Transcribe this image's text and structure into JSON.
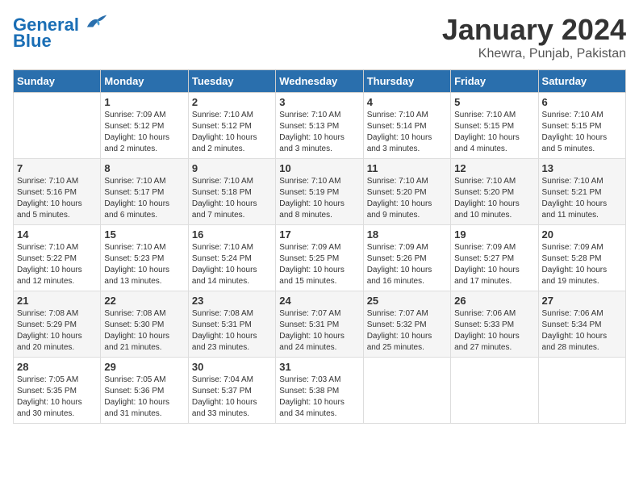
{
  "logo": {
    "line1": "General",
    "line2": "Blue"
  },
  "title": "January 2024",
  "subtitle": "Khewra, Punjab, Pakistan",
  "days_of_week": [
    "Sunday",
    "Monday",
    "Tuesday",
    "Wednesday",
    "Thursday",
    "Friday",
    "Saturday"
  ],
  "weeks": [
    [
      {
        "num": "",
        "info": ""
      },
      {
        "num": "1",
        "info": "Sunrise: 7:09 AM\nSunset: 5:12 PM\nDaylight: 10 hours\nand 2 minutes."
      },
      {
        "num": "2",
        "info": "Sunrise: 7:10 AM\nSunset: 5:12 PM\nDaylight: 10 hours\nand 2 minutes."
      },
      {
        "num": "3",
        "info": "Sunrise: 7:10 AM\nSunset: 5:13 PM\nDaylight: 10 hours\nand 3 minutes."
      },
      {
        "num": "4",
        "info": "Sunrise: 7:10 AM\nSunset: 5:14 PM\nDaylight: 10 hours\nand 3 minutes."
      },
      {
        "num": "5",
        "info": "Sunrise: 7:10 AM\nSunset: 5:15 PM\nDaylight: 10 hours\nand 4 minutes."
      },
      {
        "num": "6",
        "info": "Sunrise: 7:10 AM\nSunset: 5:15 PM\nDaylight: 10 hours\nand 5 minutes."
      }
    ],
    [
      {
        "num": "7",
        "info": "Sunrise: 7:10 AM\nSunset: 5:16 PM\nDaylight: 10 hours\nand 5 minutes."
      },
      {
        "num": "8",
        "info": "Sunrise: 7:10 AM\nSunset: 5:17 PM\nDaylight: 10 hours\nand 6 minutes."
      },
      {
        "num": "9",
        "info": "Sunrise: 7:10 AM\nSunset: 5:18 PM\nDaylight: 10 hours\nand 7 minutes."
      },
      {
        "num": "10",
        "info": "Sunrise: 7:10 AM\nSunset: 5:19 PM\nDaylight: 10 hours\nand 8 minutes."
      },
      {
        "num": "11",
        "info": "Sunrise: 7:10 AM\nSunset: 5:20 PM\nDaylight: 10 hours\nand 9 minutes."
      },
      {
        "num": "12",
        "info": "Sunrise: 7:10 AM\nSunset: 5:20 PM\nDaylight: 10 hours\nand 10 minutes."
      },
      {
        "num": "13",
        "info": "Sunrise: 7:10 AM\nSunset: 5:21 PM\nDaylight: 10 hours\nand 11 minutes."
      }
    ],
    [
      {
        "num": "14",
        "info": "Sunrise: 7:10 AM\nSunset: 5:22 PM\nDaylight: 10 hours\nand 12 minutes."
      },
      {
        "num": "15",
        "info": "Sunrise: 7:10 AM\nSunset: 5:23 PM\nDaylight: 10 hours\nand 13 minutes."
      },
      {
        "num": "16",
        "info": "Sunrise: 7:10 AM\nSunset: 5:24 PM\nDaylight: 10 hours\nand 14 minutes."
      },
      {
        "num": "17",
        "info": "Sunrise: 7:09 AM\nSunset: 5:25 PM\nDaylight: 10 hours\nand 15 minutes."
      },
      {
        "num": "18",
        "info": "Sunrise: 7:09 AM\nSunset: 5:26 PM\nDaylight: 10 hours\nand 16 minutes."
      },
      {
        "num": "19",
        "info": "Sunrise: 7:09 AM\nSunset: 5:27 PM\nDaylight: 10 hours\nand 17 minutes."
      },
      {
        "num": "20",
        "info": "Sunrise: 7:09 AM\nSunset: 5:28 PM\nDaylight: 10 hours\nand 19 minutes."
      }
    ],
    [
      {
        "num": "21",
        "info": "Sunrise: 7:08 AM\nSunset: 5:29 PM\nDaylight: 10 hours\nand 20 minutes."
      },
      {
        "num": "22",
        "info": "Sunrise: 7:08 AM\nSunset: 5:30 PM\nDaylight: 10 hours\nand 21 minutes."
      },
      {
        "num": "23",
        "info": "Sunrise: 7:08 AM\nSunset: 5:31 PM\nDaylight: 10 hours\nand 23 minutes."
      },
      {
        "num": "24",
        "info": "Sunrise: 7:07 AM\nSunset: 5:31 PM\nDaylight: 10 hours\nand 24 minutes."
      },
      {
        "num": "25",
        "info": "Sunrise: 7:07 AM\nSunset: 5:32 PM\nDaylight: 10 hours\nand 25 minutes."
      },
      {
        "num": "26",
        "info": "Sunrise: 7:06 AM\nSunset: 5:33 PM\nDaylight: 10 hours\nand 27 minutes."
      },
      {
        "num": "27",
        "info": "Sunrise: 7:06 AM\nSunset: 5:34 PM\nDaylight: 10 hours\nand 28 minutes."
      }
    ],
    [
      {
        "num": "28",
        "info": "Sunrise: 7:05 AM\nSunset: 5:35 PM\nDaylight: 10 hours\nand 30 minutes."
      },
      {
        "num": "29",
        "info": "Sunrise: 7:05 AM\nSunset: 5:36 PM\nDaylight: 10 hours\nand 31 minutes."
      },
      {
        "num": "30",
        "info": "Sunrise: 7:04 AM\nSunset: 5:37 PM\nDaylight: 10 hours\nand 33 minutes."
      },
      {
        "num": "31",
        "info": "Sunrise: 7:03 AM\nSunset: 5:38 PM\nDaylight: 10 hours\nand 34 minutes."
      },
      {
        "num": "",
        "info": ""
      },
      {
        "num": "",
        "info": ""
      },
      {
        "num": "",
        "info": ""
      }
    ]
  ]
}
